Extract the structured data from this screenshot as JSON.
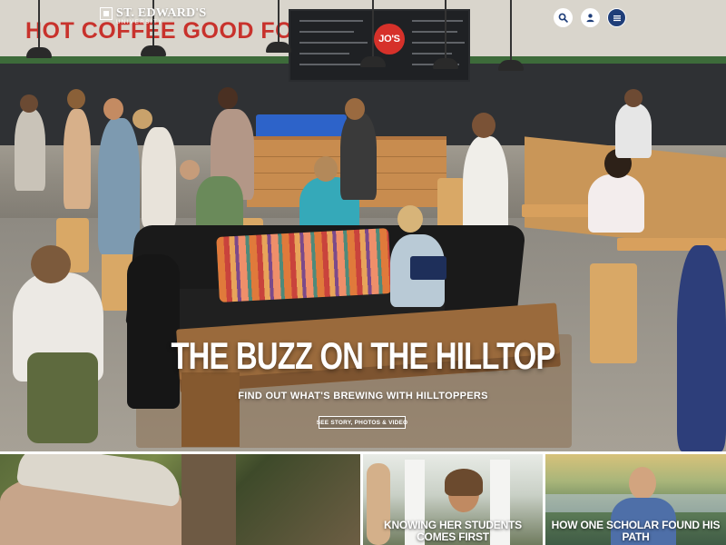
{
  "header": {
    "logo_text": "ST. EDWARD'S",
    "logo_subtext": "UNIVERSITY",
    "icons": {
      "search": "search-icon",
      "account": "user-icon",
      "menu": "menu-icon"
    },
    "colors": {
      "icon_bg": "#ffffff",
      "icon_glyph": "#1f3e79",
      "menu_bg": "#1f3e79"
    }
  },
  "scene": {
    "wall_sign": "HOT COFFEE GOOD FOOD",
    "cafe_logo": "JO'S"
  },
  "hero": {
    "title": "THE BUZZ ON THE HILLTOP",
    "subtitle": "FIND OUT WHAT'S BREWING WITH HILLTOPPERS",
    "cta_label": "SEE STORY, PHOTOS & VIDEO"
  },
  "tiles": [
    {
      "caption": ""
    },
    {
      "caption": "KNOWING HER STUDENTS COMES FIRST"
    },
    {
      "caption": "HOW ONE SCHOLAR FOUND HIS PATH"
    }
  ]
}
